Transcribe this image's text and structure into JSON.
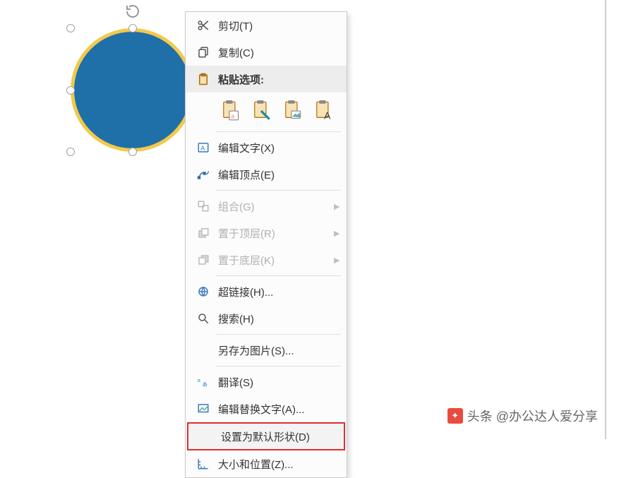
{
  "shape": {
    "fill": "#1f6fa8",
    "stroke": "#f2c94c"
  },
  "menu": {
    "cut": "剪切(T)",
    "copy": "复制(C)",
    "paste_header": "粘贴选项:",
    "paste_opts": {
      "keep_source": "clipboard-keep-source",
      "merge": "clipboard-merge",
      "picture": "clipboard-picture",
      "text_only": "clipboard-text-only"
    },
    "edit_text": "编辑文字(X)",
    "edit_points": "编辑顶点(E)",
    "group": "组合(G)",
    "bring_front": "置于顶层(R)",
    "send_back": "置于底层(K)",
    "hyperlink": "超链接(H)...",
    "search": "搜索(H)",
    "save_as_pic": "另存为图片(S)...",
    "translate": "翻译(S)",
    "alt_text": "编辑替换文字(A)...",
    "set_default_shape": "设置为默认形状(D)",
    "size_position": "大小和位置(Z)..."
  },
  "watermark": {
    "text": "头条 @办公达人爱分享"
  }
}
